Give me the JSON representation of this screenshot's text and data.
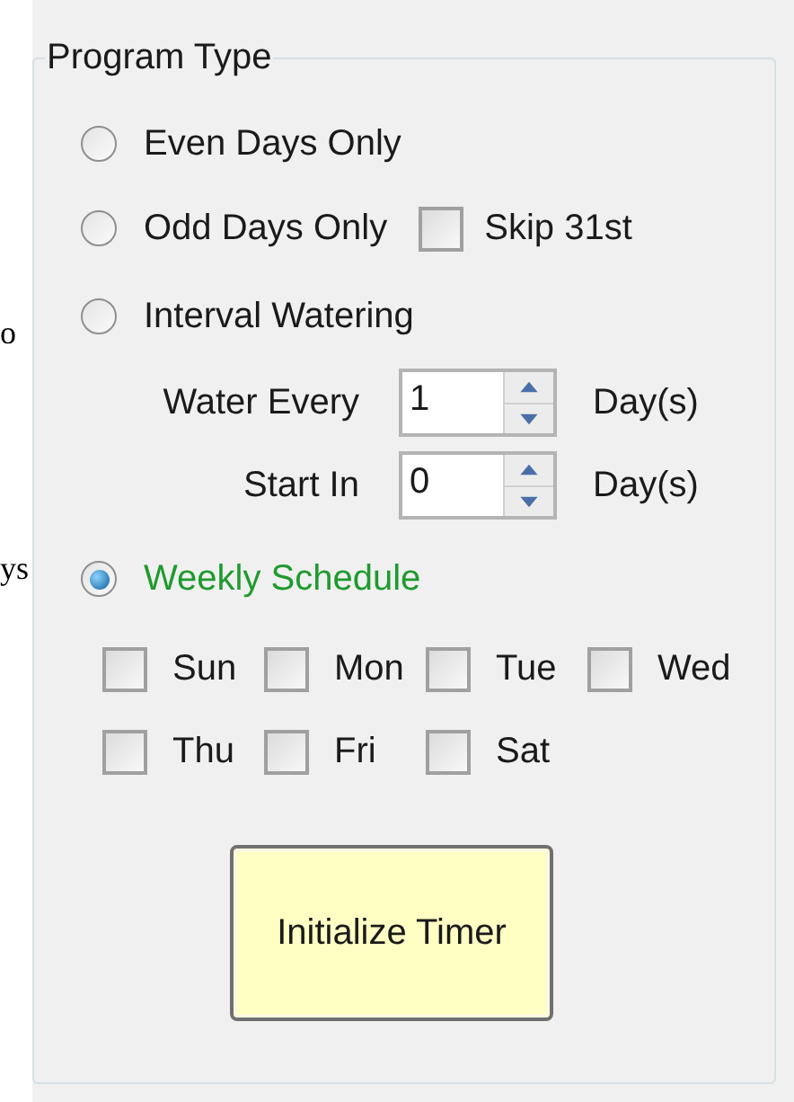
{
  "left_fragments": [
    "o",
    "ys"
  ],
  "group": {
    "title": "Program Type"
  },
  "options": [
    {
      "label": "Even Days Only",
      "selected": false
    },
    {
      "label": "Odd Days Only",
      "selected": false,
      "checkbox": {
        "label": "Skip 31st",
        "checked": false
      }
    },
    {
      "label": "Interval Watering",
      "selected": false,
      "spinners": [
        {
          "label": "Water Every",
          "value": "1",
          "unit": "Day(s)"
        },
        {
          "label": "Start In",
          "value": "0",
          "unit": "Day(s)"
        }
      ]
    },
    {
      "label": "Weekly Schedule",
      "selected": true,
      "days": [
        {
          "label": "Sun",
          "checked": false
        },
        {
          "label": "Mon",
          "checked": false
        },
        {
          "label": "Tue",
          "checked": false
        },
        {
          "label": "Wed",
          "checked": false
        },
        {
          "label": "Thu",
          "checked": false
        },
        {
          "label": "Fri",
          "checked": false
        },
        {
          "label": "Sat",
          "checked": false
        }
      ]
    }
  ],
  "button": {
    "label": "Initialize Timer"
  }
}
